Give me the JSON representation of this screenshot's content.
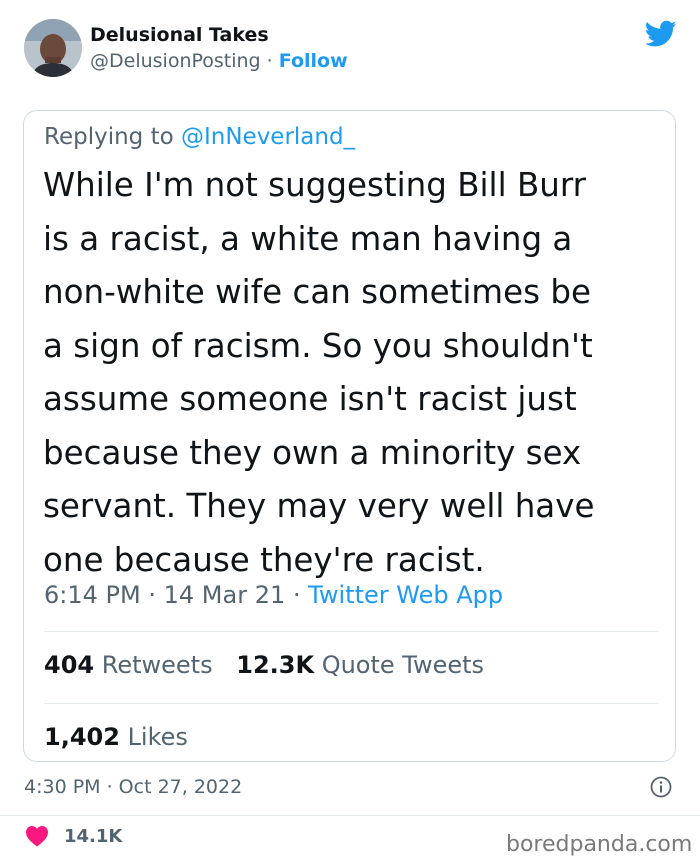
{
  "author": {
    "display_name": "Delusional Takes",
    "handle": "@DelusionPosting",
    "separator": "·",
    "follow_label": "Follow"
  },
  "embedded_tweet": {
    "replying_prefix": "Replying to",
    "replying_mention": "@InNeverland_",
    "text": "While I'm not suggesting Bill Burr\nis a racist, a white man having a\nnon-white wife can sometimes be\na sign of racism.  So you shouldn't\nassume someone isn't racist just\nbecause they own a minority sex\nservant.   They may very well have\none because they're racist.",
    "time": "6:14 PM",
    "date": "14 Mar 21",
    "app": "Twitter Web App",
    "retweets_count": "404",
    "retweets_label": "Retweets",
    "quote_count": "12.3K",
    "quote_label": "Quote Tweets",
    "likes_count": "1,402",
    "likes_label": "Likes"
  },
  "footer": {
    "timestamp": "4:30 PM · Oct 27, 2022",
    "like_count": "14.1K",
    "watermark": "boredpanda.com"
  },
  "colors": {
    "twitter_blue": "#1d9bf0",
    "text_primary": "#0f1419",
    "text_secondary": "#536471",
    "like_pink": "#f91880"
  },
  "icons": {
    "logo": "twitter-bird-icon",
    "info": "info-icon",
    "like": "heart-icon"
  }
}
